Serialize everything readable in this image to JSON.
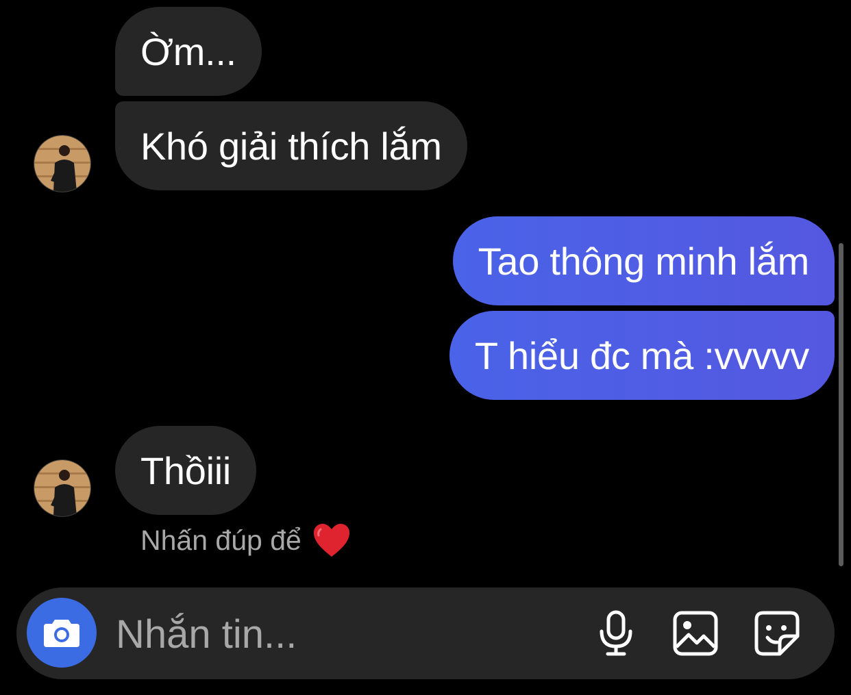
{
  "messages": [
    {
      "direction": "incoming",
      "text": "Ờm..."
    },
    {
      "direction": "incoming",
      "text": "Khó giải thích lắm"
    },
    {
      "direction": "outgoing",
      "text": "Tao thông minh lắm"
    },
    {
      "direction": "outgoing",
      "text": "T hiểu đc mà :vvvvv"
    },
    {
      "direction": "incoming",
      "text": "Thồiii"
    }
  ],
  "hint": {
    "text": "Nhấn đúp để",
    "icon": "heart-icon"
  },
  "composer": {
    "placeholder": "Nhắn tin...",
    "icons": [
      "camera-icon",
      "microphone-icon",
      "gallery-icon",
      "sticker-icon"
    ]
  },
  "colors": {
    "background": "#000000",
    "incoming_bubble": "#262626",
    "outgoing_bubble": "#4f5fe6",
    "camera_button": "#3b6ce4",
    "hint_text": "#a8a8a8",
    "heart": "#e0242f"
  }
}
